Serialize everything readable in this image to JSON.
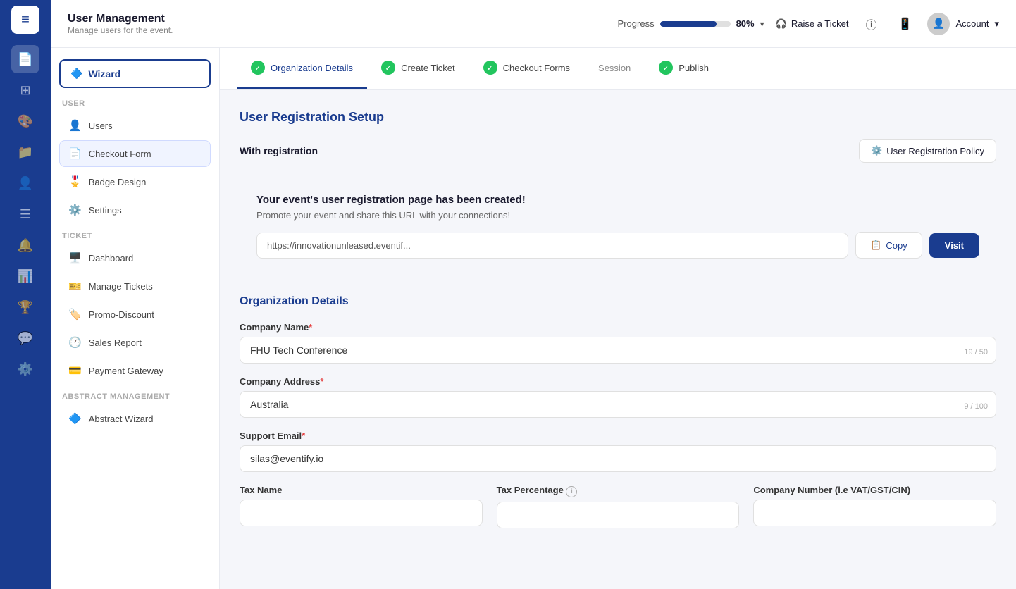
{
  "app": {
    "title": "User Management",
    "subtitle": "Manage users for the event."
  },
  "topbar": {
    "progress_label": "Progress",
    "progress_pct": "80%",
    "progress_value": 80,
    "raise_ticket": "Raise a Ticket",
    "account": "Account",
    "dropdown_arrow": "▾"
  },
  "sidebar": {
    "wizard_label": "Wizard",
    "sections": [
      {
        "label": "User",
        "items": [
          {
            "id": "users",
            "label": "Users",
            "icon": "👤"
          },
          {
            "id": "checkout-form",
            "label": "Checkout Form",
            "icon": "📄",
            "active": true
          },
          {
            "id": "badge-design",
            "label": "Badge Design",
            "icon": "🎖️"
          },
          {
            "id": "settings",
            "label": "Settings",
            "icon": "⚙️"
          }
        ]
      },
      {
        "label": "Ticket",
        "items": [
          {
            "id": "dashboard",
            "label": "Dashboard",
            "icon": "🖥️"
          },
          {
            "id": "manage-tickets",
            "label": "Manage Tickets",
            "icon": "🎫"
          },
          {
            "id": "promo-discount",
            "label": "Promo-Discount",
            "icon": "🏷️"
          },
          {
            "id": "sales-report",
            "label": "Sales Report",
            "icon": "🕐"
          },
          {
            "id": "payment-gateway",
            "label": "Payment Gateway",
            "icon": "💳"
          }
        ]
      },
      {
        "label": "Abstract Management",
        "items": [
          {
            "id": "abstract-wizard",
            "label": "Abstract Wizard",
            "icon": "🔷"
          }
        ]
      }
    ]
  },
  "wizard_tabs": [
    {
      "id": "org-details",
      "label": "Organization Details",
      "completed": true,
      "active": true
    },
    {
      "id": "create-ticket",
      "label": "Create Ticket",
      "completed": true
    },
    {
      "id": "checkout-forms",
      "label": "Checkout Forms",
      "completed": true
    },
    {
      "id": "session",
      "label": "Session",
      "completed": false
    },
    {
      "id": "publish",
      "label": "Publish",
      "completed": true
    }
  ],
  "main": {
    "page_title": "User Registration Setup",
    "with_registration_label": "With registration",
    "policy_btn_label": "User Registration Policy",
    "url_card": {
      "heading": "Your event's user registration page has been created!",
      "subtext": "Promote your event and share this URL with your connections!",
      "url_value": "https://innovationunleased.eventif...",
      "copy_label": "Copy",
      "visit_label": "Visit"
    },
    "org_section_title": "Organization Details",
    "company_name_label": "Company Name",
    "company_name_value": "FHU Tech Conference",
    "company_name_char": "19 / 50",
    "company_address_label": "Company Address",
    "company_address_value": "Australia",
    "company_address_char": "9 / 100",
    "support_email_label": "Support Email",
    "support_email_value": "silas@eventify.io",
    "tax_name_label": "Tax Name",
    "tax_percentage_label": "Tax Percentage",
    "company_number_label": "Company Number (i.e VAT/GST/CIN)"
  },
  "icons": {
    "wizard": "🔷",
    "check": "✓",
    "copy": "📋",
    "gear": "⚙️",
    "headphones": "🎧",
    "info": "ⓘ",
    "mobile": "📱",
    "user": "👤"
  }
}
